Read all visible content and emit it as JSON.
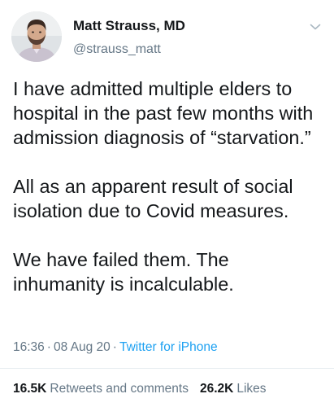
{
  "tweet": {
    "author": {
      "name": "Matt Strauss, MD",
      "handle": "@strauss_matt"
    },
    "icons": {
      "avatar": "profile-photo",
      "caret": "chevron-down-icon"
    },
    "paragraphs": [
      "I have admitted multiple elders to hospital in the past few months with admission diagnosis of “starvation.”",
      "All as an apparent result of social isolation due to Covid measures.",
      "We have failed them. The inhumanity is incalculable."
    ],
    "meta": {
      "time": "16:36",
      "separator": "·",
      "date": "08 Aug 20",
      "source": "Twitter for iPhone"
    },
    "stats": {
      "retweets_count": "16.5K",
      "retweets_label": "Retweets and comments",
      "likes_count": "26.2K",
      "likes_label": "Likes"
    },
    "colors": {
      "text": "#14171a",
      "secondary": "#657786",
      "link": "#1da1f2"
    }
  }
}
